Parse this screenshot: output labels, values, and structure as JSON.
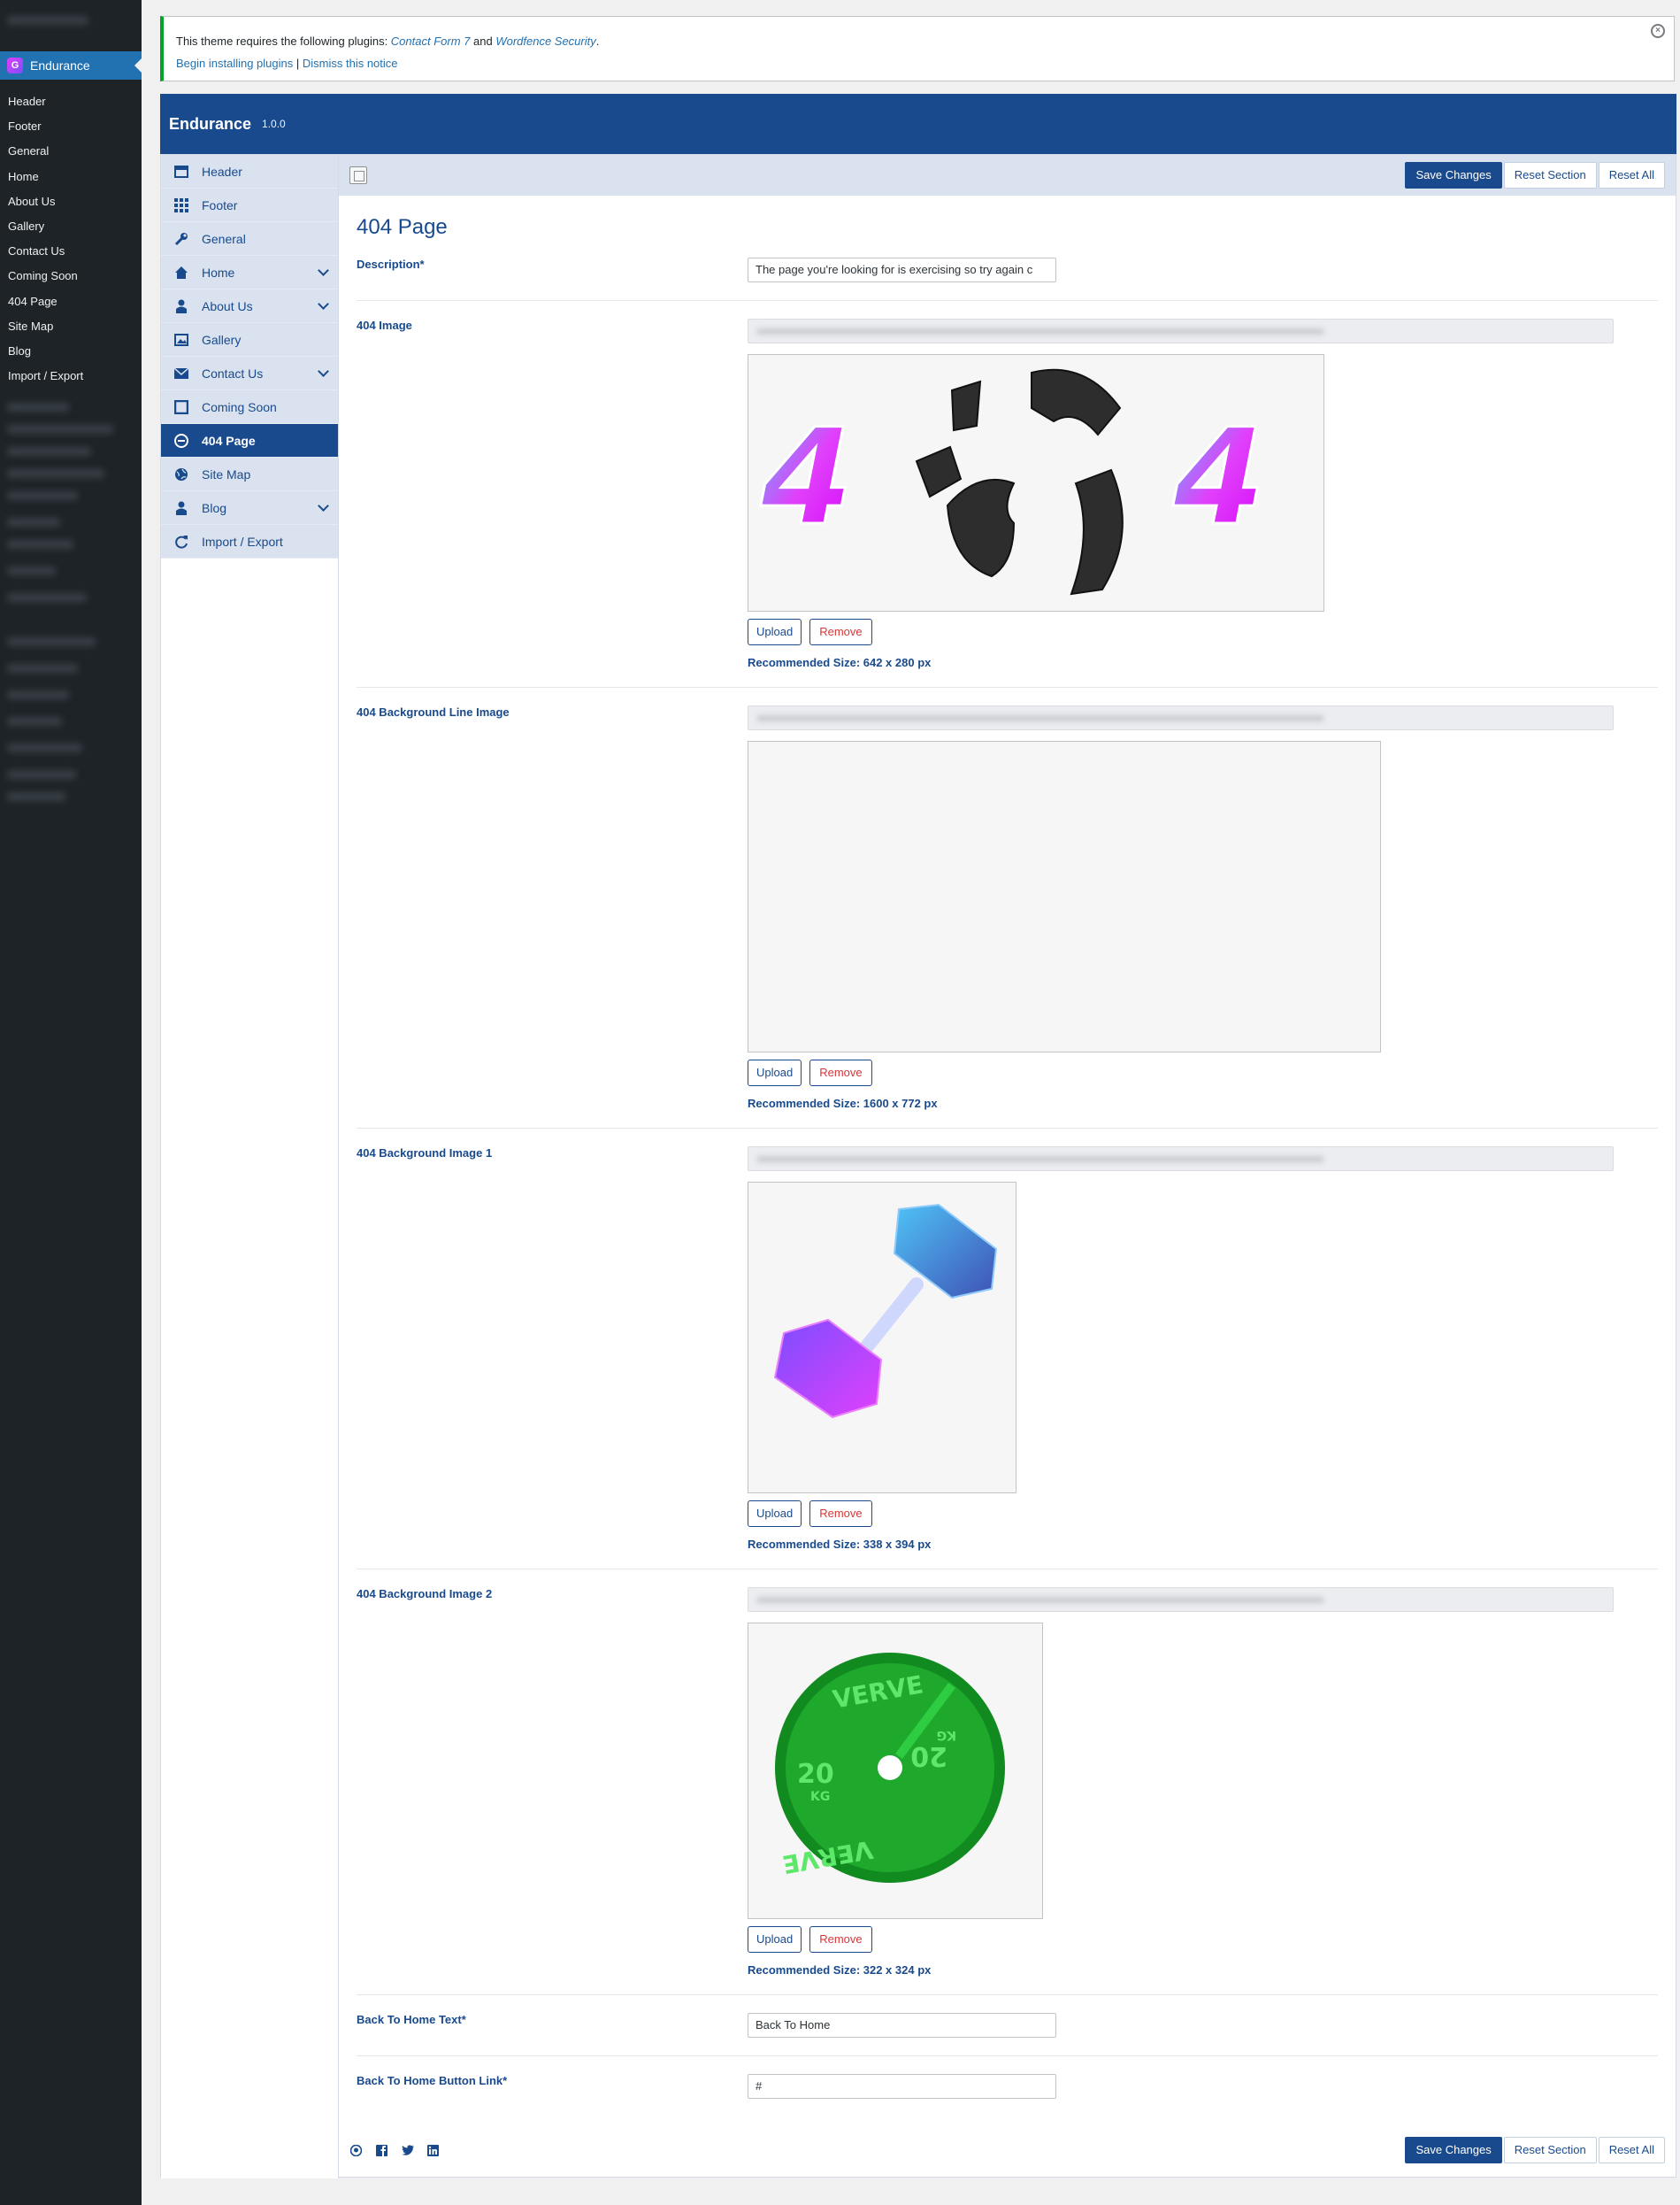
{
  "wp_menu": {
    "current": "Endurance",
    "items": [
      "Header",
      "Footer",
      "General",
      "Home",
      "About Us",
      "Gallery",
      "Contact Us",
      "Coming Soon",
      "404 Page",
      "Site Map",
      "Blog",
      "Import / Export"
    ]
  },
  "notice": {
    "text_prefix": "This theme requires the following plugins: ",
    "plugin1": "Contact Form 7",
    "and": " and ",
    "plugin2": "Wordfence Security",
    "suffix": ".",
    "link_install": "Begin installing plugins",
    "separator": " | ",
    "link_dismiss": "Dismiss this notice"
  },
  "header": {
    "title": "Endurance",
    "version": "1.0.0"
  },
  "nav": [
    {
      "label": "Header",
      "icon": "layout-icon"
    },
    {
      "label": "Footer",
      "icon": "grid-icon"
    },
    {
      "label": "General",
      "icon": "wrench-icon"
    },
    {
      "label": "Home",
      "icon": "home-icon"
    },
    {
      "label": "About Us",
      "icon": "person-icon"
    },
    {
      "label": "Gallery",
      "icon": "image-icon"
    },
    {
      "label": "Contact Us",
      "icon": "envelope-icon"
    },
    {
      "label": "Coming Soon",
      "icon": "square-icon"
    },
    {
      "label": "404 Page",
      "icon": "no-entry-icon"
    },
    {
      "label": "Site Map",
      "icon": "globe-icon"
    },
    {
      "label": "Blog",
      "icon": "person-icon"
    },
    {
      "label": "Import / Export",
      "icon": "refresh-icon"
    }
  ],
  "toolbar": {
    "save": "Save Changes",
    "reset_section": "Reset Section",
    "reset_all": "Reset All"
  },
  "section": {
    "title": "404 Page",
    "description": {
      "label": "Description*",
      "value": "The page you're looking for is exercising so try again c"
    },
    "image": {
      "label": "404 Image",
      "recommended": "Recommended Size: 642 x 280 px"
    },
    "bg_line": {
      "label": "404 Background Line Image",
      "recommended": "Recommended Size: 1600 x 772 px"
    },
    "bg1": {
      "label": "404 Background Image 1",
      "recommended": "Recommended Size: 338 x 394 px"
    },
    "bg2": {
      "label": "404 Background Image 2",
      "recommended": "Recommended Size: 322 x 324 px"
    },
    "home_text": {
      "label": "Back To Home Text*",
      "value": "Back To Home"
    },
    "home_link": {
      "label": "Back To Home Button Link*",
      "value": "#"
    },
    "upload": "Upload",
    "remove": "Remove"
  },
  "plate_text": {
    "brand": "VERVE",
    "weight": "20",
    "unit": "KG"
  },
  "digits": {
    "four": "4"
  },
  "colors": {
    "primary": "#194a8d",
    "nav_bg": "#d9e2ee",
    "wp_dark": "#1d2327",
    "notice_green": "#00a32a",
    "remove_red": "#d63638"
  }
}
